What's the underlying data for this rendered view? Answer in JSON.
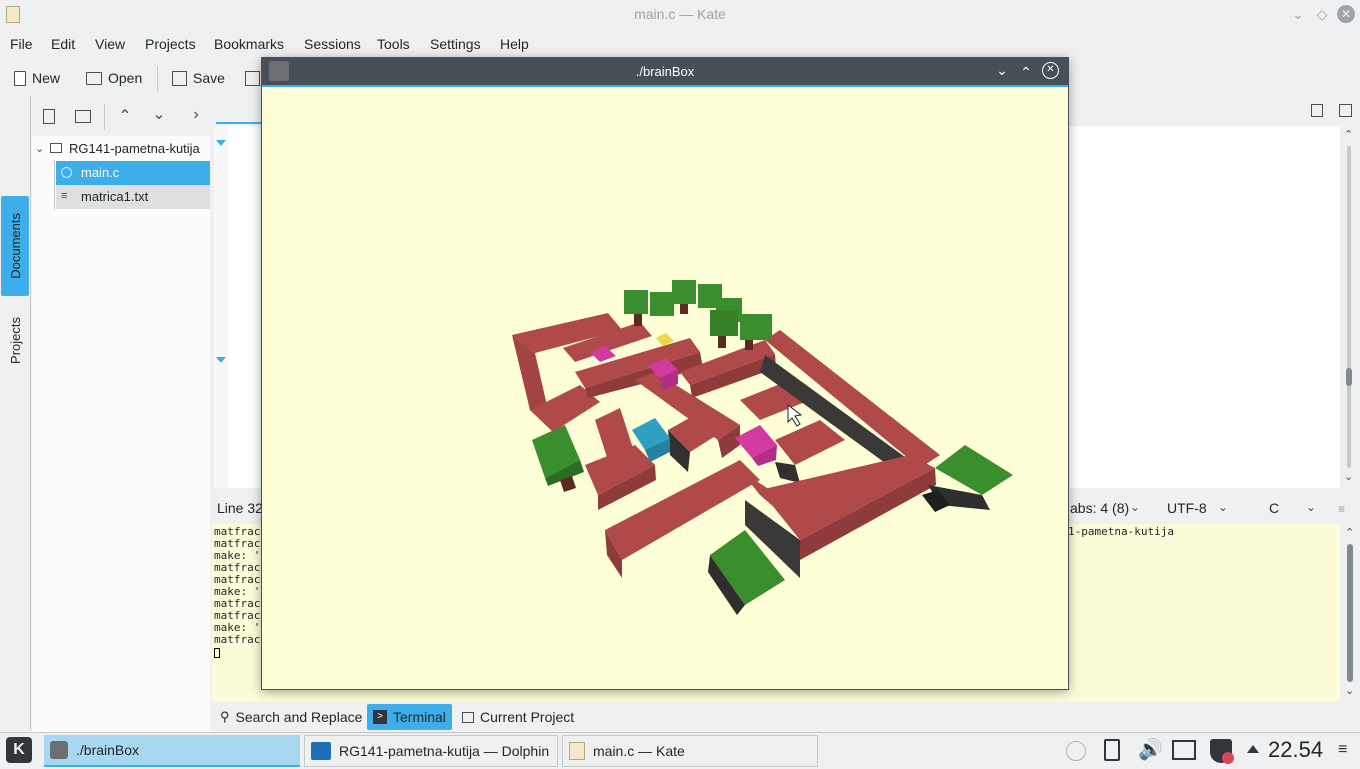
{
  "kate": {
    "title": "main.c  — Kate",
    "menu": [
      "File",
      "Edit",
      "View",
      "Projects",
      "Bookmarks",
      "Sessions",
      "Tools",
      "Settings",
      "Help"
    ],
    "toolbar": {
      "new_label": "New",
      "open_label": "Open",
      "save_label": "Save"
    },
    "sidebar_tabs": {
      "documents": "Documents",
      "projects": "Projects"
    },
    "tree": {
      "project": "RG141-pametna-kutija",
      "files": [
        "main.c",
        "matrica1.txt"
      ],
      "selected": "main.c"
    },
    "status": {
      "line": "Line 32",
      "tabs": "abs: 4 (8)",
      "encoding": "UTF-8",
      "mode": "C"
    },
    "terminal": {
      "lines": [
        "matfrac",
        "matfrac",
        "make: '",
        "matfrac",
        "matfrac",
        "make: '",
        "matfrac",
        "matfrac",
        "make: '",
        "matfrac"
      ],
      "right_text": "1-pametna-kutija"
    },
    "bottom_tabs": {
      "search": "Search and Replace",
      "terminal": "Terminal",
      "project": "Current Project"
    },
    "active_bottom_tab": "Terminal"
  },
  "brainbox": {
    "title": "./brainBox"
  },
  "taskbar": {
    "tasks": [
      "./brainBox",
      "RG141-pametna-kutija — Dolphin",
      "main.c  — Kate"
    ],
    "clock": "22.54"
  },
  "colors": {
    "accent": "#3daee9",
    "canvas_bg": "#fefed7",
    "wall": "#b04a4a",
    "tree_green": "#3a8e2e",
    "box_pink": "#d4399d",
    "box_cyan": "#2f9fc2"
  }
}
